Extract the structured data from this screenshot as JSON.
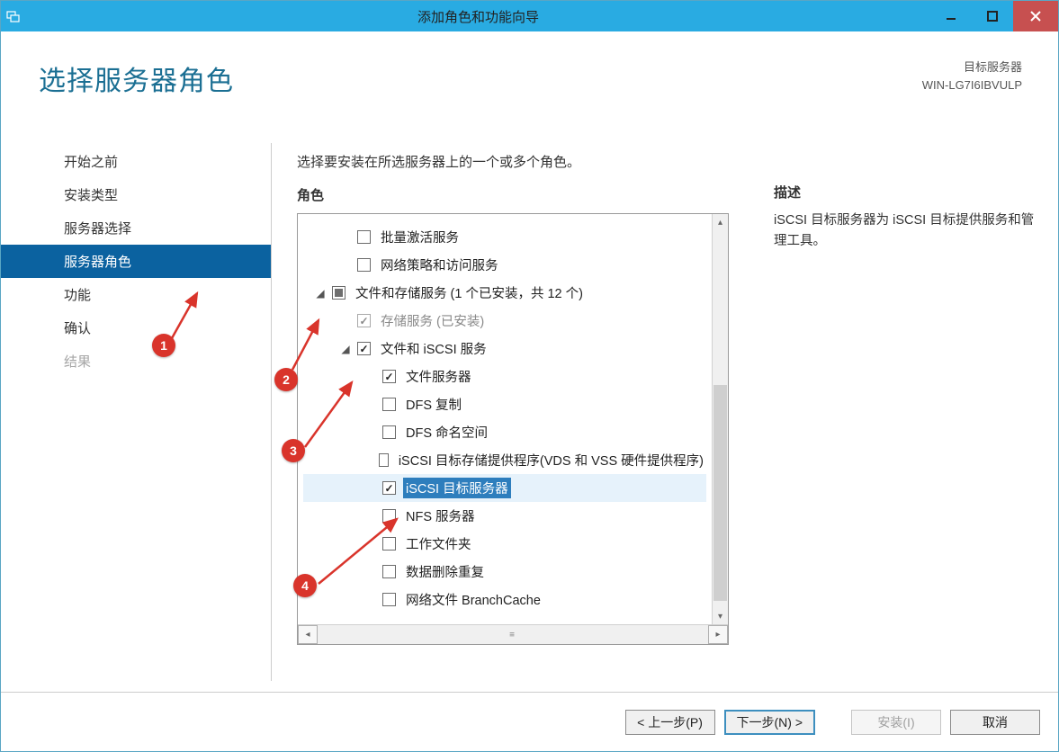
{
  "window": {
    "title": "添加角色和功能向导"
  },
  "header": {
    "page_title": "选择服务器角色",
    "target_label": "目标服务器",
    "target_server": "WIN-LG7I6IBVULP"
  },
  "nav": {
    "items": [
      {
        "label": "开始之前",
        "state": "normal"
      },
      {
        "label": "安装类型",
        "state": "normal"
      },
      {
        "label": "服务器选择",
        "state": "normal"
      },
      {
        "label": "服务器角色",
        "state": "active"
      },
      {
        "label": "功能",
        "state": "normal"
      },
      {
        "label": "确认",
        "state": "normal"
      },
      {
        "label": "结果",
        "state": "disabled"
      }
    ]
  },
  "main": {
    "instruction": "选择要安装在所选服务器上的一个或多个角色。",
    "roles_heading": "角色",
    "desc_heading": "描述",
    "desc_text": "iSCSI 目标服务器为 iSCSI 目标提供服务和管理工具。",
    "tree": [
      {
        "indent": 1,
        "expander": "none",
        "cb": "unchecked",
        "label": "批量激活服务"
      },
      {
        "indent": 1,
        "expander": "none",
        "cb": "unchecked",
        "label": "网络策略和访问服务"
      },
      {
        "indent": 0,
        "expander": "open",
        "cb": "indet",
        "label": "文件和存储服务 (1 个已安装，共 12 个)"
      },
      {
        "indent": 1,
        "expander": "none",
        "cb": "checked",
        "label": "存储服务 (已安装)",
        "installed": true
      },
      {
        "indent": 1,
        "expander": "open",
        "cb": "checked",
        "label": "文件和 iSCSI 服务"
      },
      {
        "indent": 2,
        "expander": "none",
        "cb": "checked",
        "label": "文件服务器"
      },
      {
        "indent": 2,
        "expander": "none",
        "cb": "unchecked",
        "label": "DFS 复制"
      },
      {
        "indent": 2,
        "expander": "none",
        "cb": "unchecked",
        "label": "DFS 命名空间"
      },
      {
        "indent": 2,
        "expander": "none",
        "cb": "unchecked",
        "label": "iSCSI 目标存储提供程序(VDS 和 VSS 硬件提供程序)"
      },
      {
        "indent": 2,
        "expander": "none",
        "cb": "checked",
        "label": "iSCSI 目标服务器",
        "highlight": true
      },
      {
        "indent": 2,
        "expander": "none",
        "cb": "unchecked",
        "label": "NFS 服务器"
      },
      {
        "indent": 2,
        "expander": "none",
        "cb": "unchecked",
        "label": "工作文件夹"
      },
      {
        "indent": 2,
        "expander": "none",
        "cb": "unchecked",
        "label": "数据删除重复"
      },
      {
        "indent": 2,
        "expander": "none",
        "cb": "unchecked",
        "label": "网络文件 BranchCache"
      }
    ]
  },
  "footer": {
    "prev": "< 上一步(P)",
    "next": "下一步(N) >",
    "install": "安装(I)",
    "cancel": "取消"
  },
  "annotations": {
    "markers": [
      "1",
      "2",
      "3",
      "4"
    ]
  }
}
